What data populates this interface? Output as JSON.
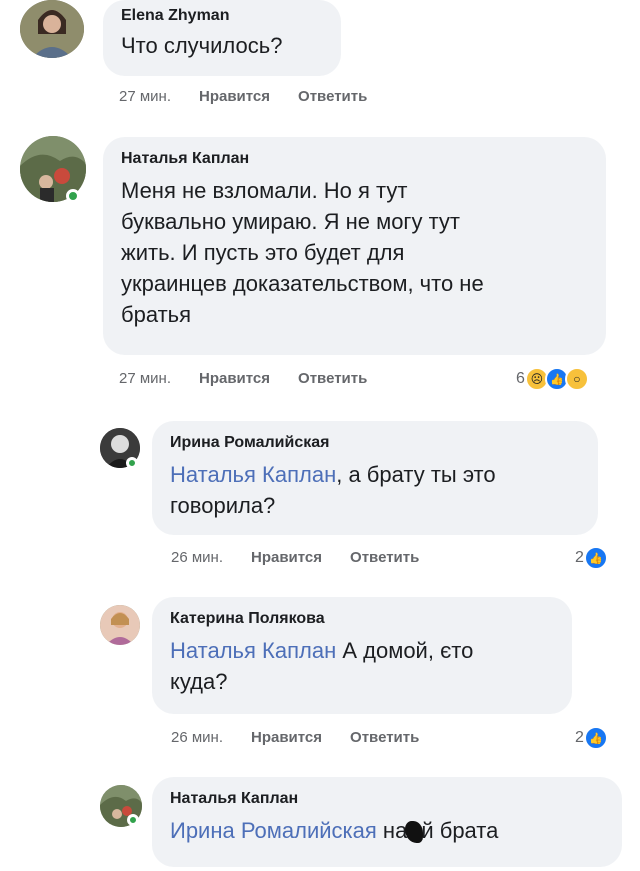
{
  "comments": [
    {
      "author": "Elena Zhyman",
      "text": "Что случилось?",
      "time": "27 мин.",
      "like": "Нравится",
      "reply": "Ответить"
    },
    {
      "author": "Наталья Каплан",
      "text_lines": [
        "Меня не взломали. Но я тут",
        "буквально умираю. Я не могу тут",
        "жить. И пусть это будет для",
        "украинцев доказательством, что не",
        "братья"
      ],
      "time": "27 мин.",
      "like": "Нравится",
      "reply": "Ответить",
      "reaction_count": "6",
      "reaction_icons": [
        "sad-icon",
        "like-icon",
        "wow-icon"
      ]
    },
    {
      "author": "Ирина Ромалийская",
      "mention": "Наталья Каплан",
      "text_after": ", а брату ты это",
      "text_line2": "говорила?",
      "time": "26 мин.",
      "like": "Нравится",
      "reply": "Ответить",
      "reaction_count": "2",
      "reaction_icons": [
        "like-icon"
      ]
    },
    {
      "author": "Катерина Полякова",
      "mention": "Наталья Каплан",
      "text_after": " А домой, єто",
      "text_line2": "куда?",
      "time": "26 мин.",
      "like": "Нравится",
      "reply": "Ответить",
      "reaction_count": "2",
      "reaction_icons": [
        "like-icon"
      ]
    },
    {
      "author": "Наталья Каплан",
      "mention": "Ирина Ромалийская",
      "text_before_censor": " на",
      "text_after_censor": "й брата"
    }
  ],
  "colors": {
    "bubble": "#f0f2f5",
    "mention": "#4d6fb8",
    "meta": "#65676b",
    "online": "#31a24c",
    "like": "#1877f2"
  }
}
